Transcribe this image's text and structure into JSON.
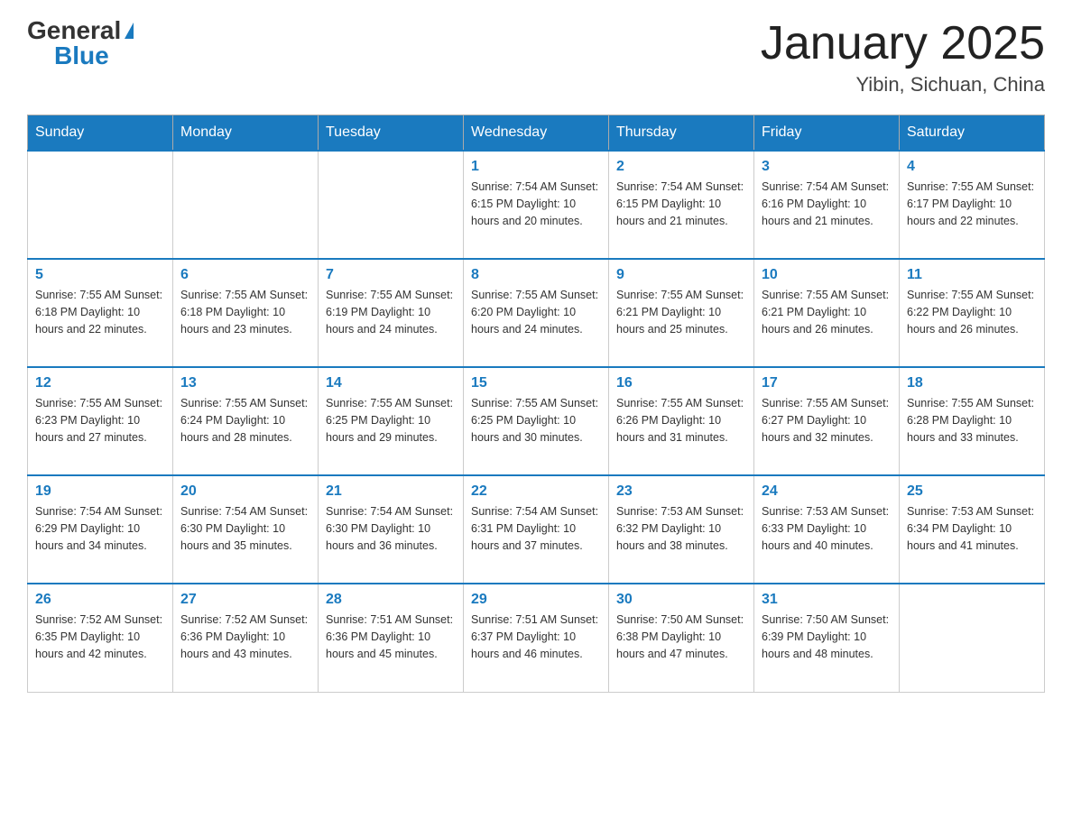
{
  "header": {
    "logo_general": "General",
    "logo_blue": "Blue",
    "title": "January 2025",
    "subtitle": "Yibin, Sichuan, China"
  },
  "weekdays": [
    "Sunday",
    "Monday",
    "Tuesday",
    "Wednesday",
    "Thursday",
    "Friday",
    "Saturday"
  ],
  "weeks": [
    [
      {
        "day": "",
        "info": ""
      },
      {
        "day": "",
        "info": ""
      },
      {
        "day": "",
        "info": ""
      },
      {
        "day": "1",
        "info": "Sunrise: 7:54 AM\nSunset: 6:15 PM\nDaylight: 10 hours\nand 20 minutes."
      },
      {
        "day": "2",
        "info": "Sunrise: 7:54 AM\nSunset: 6:15 PM\nDaylight: 10 hours\nand 21 minutes."
      },
      {
        "day": "3",
        "info": "Sunrise: 7:54 AM\nSunset: 6:16 PM\nDaylight: 10 hours\nand 21 minutes."
      },
      {
        "day": "4",
        "info": "Sunrise: 7:55 AM\nSunset: 6:17 PM\nDaylight: 10 hours\nand 22 minutes."
      }
    ],
    [
      {
        "day": "5",
        "info": "Sunrise: 7:55 AM\nSunset: 6:18 PM\nDaylight: 10 hours\nand 22 minutes."
      },
      {
        "day": "6",
        "info": "Sunrise: 7:55 AM\nSunset: 6:18 PM\nDaylight: 10 hours\nand 23 minutes."
      },
      {
        "day": "7",
        "info": "Sunrise: 7:55 AM\nSunset: 6:19 PM\nDaylight: 10 hours\nand 24 minutes."
      },
      {
        "day": "8",
        "info": "Sunrise: 7:55 AM\nSunset: 6:20 PM\nDaylight: 10 hours\nand 24 minutes."
      },
      {
        "day": "9",
        "info": "Sunrise: 7:55 AM\nSunset: 6:21 PM\nDaylight: 10 hours\nand 25 minutes."
      },
      {
        "day": "10",
        "info": "Sunrise: 7:55 AM\nSunset: 6:21 PM\nDaylight: 10 hours\nand 26 minutes."
      },
      {
        "day": "11",
        "info": "Sunrise: 7:55 AM\nSunset: 6:22 PM\nDaylight: 10 hours\nand 26 minutes."
      }
    ],
    [
      {
        "day": "12",
        "info": "Sunrise: 7:55 AM\nSunset: 6:23 PM\nDaylight: 10 hours\nand 27 minutes."
      },
      {
        "day": "13",
        "info": "Sunrise: 7:55 AM\nSunset: 6:24 PM\nDaylight: 10 hours\nand 28 minutes."
      },
      {
        "day": "14",
        "info": "Sunrise: 7:55 AM\nSunset: 6:25 PM\nDaylight: 10 hours\nand 29 minutes."
      },
      {
        "day": "15",
        "info": "Sunrise: 7:55 AM\nSunset: 6:25 PM\nDaylight: 10 hours\nand 30 minutes."
      },
      {
        "day": "16",
        "info": "Sunrise: 7:55 AM\nSunset: 6:26 PM\nDaylight: 10 hours\nand 31 minutes."
      },
      {
        "day": "17",
        "info": "Sunrise: 7:55 AM\nSunset: 6:27 PM\nDaylight: 10 hours\nand 32 minutes."
      },
      {
        "day": "18",
        "info": "Sunrise: 7:55 AM\nSunset: 6:28 PM\nDaylight: 10 hours\nand 33 minutes."
      }
    ],
    [
      {
        "day": "19",
        "info": "Sunrise: 7:54 AM\nSunset: 6:29 PM\nDaylight: 10 hours\nand 34 minutes."
      },
      {
        "day": "20",
        "info": "Sunrise: 7:54 AM\nSunset: 6:30 PM\nDaylight: 10 hours\nand 35 minutes."
      },
      {
        "day": "21",
        "info": "Sunrise: 7:54 AM\nSunset: 6:30 PM\nDaylight: 10 hours\nand 36 minutes."
      },
      {
        "day": "22",
        "info": "Sunrise: 7:54 AM\nSunset: 6:31 PM\nDaylight: 10 hours\nand 37 minutes."
      },
      {
        "day": "23",
        "info": "Sunrise: 7:53 AM\nSunset: 6:32 PM\nDaylight: 10 hours\nand 38 minutes."
      },
      {
        "day": "24",
        "info": "Sunrise: 7:53 AM\nSunset: 6:33 PM\nDaylight: 10 hours\nand 40 minutes."
      },
      {
        "day": "25",
        "info": "Sunrise: 7:53 AM\nSunset: 6:34 PM\nDaylight: 10 hours\nand 41 minutes."
      }
    ],
    [
      {
        "day": "26",
        "info": "Sunrise: 7:52 AM\nSunset: 6:35 PM\nDaylight: 10 hours\nand 42 minutes."
      },
      {
        "day": "27",
        "info": "Sunrise: 7:52 AM\nSunset: 6:36 PM\nDaylight: 10 hours\nand 43 minutes."
      },
      {
        "day": "28",
        "info": "Sunrise: 7:51 AM\nSunset: 6:36 PM\nDaylight: 10 hours\nand 45 minutes."
      },
      {
        "day": "29",
        "info": "Sunrise: 7:51 AM\nSunset: 6:37 PM\nDaylight: 10 hours\nand 46 minutes."
      },
      {
        "day": "30",
        "info": "Sunrise: 7:50 AM\nSunset: 6:38 PM\nDaylight: 10 hours\nand 47 minutes."
      },
      {
        "day": "31",
        "info": "Sunrise: 7:50 AM\nSunset: 6:39 PM\nDaylight: 10 hours\nand 48 minutes."
      },
      {
        "day": "",
        "info": ""
      }
    ]
  ]
}
